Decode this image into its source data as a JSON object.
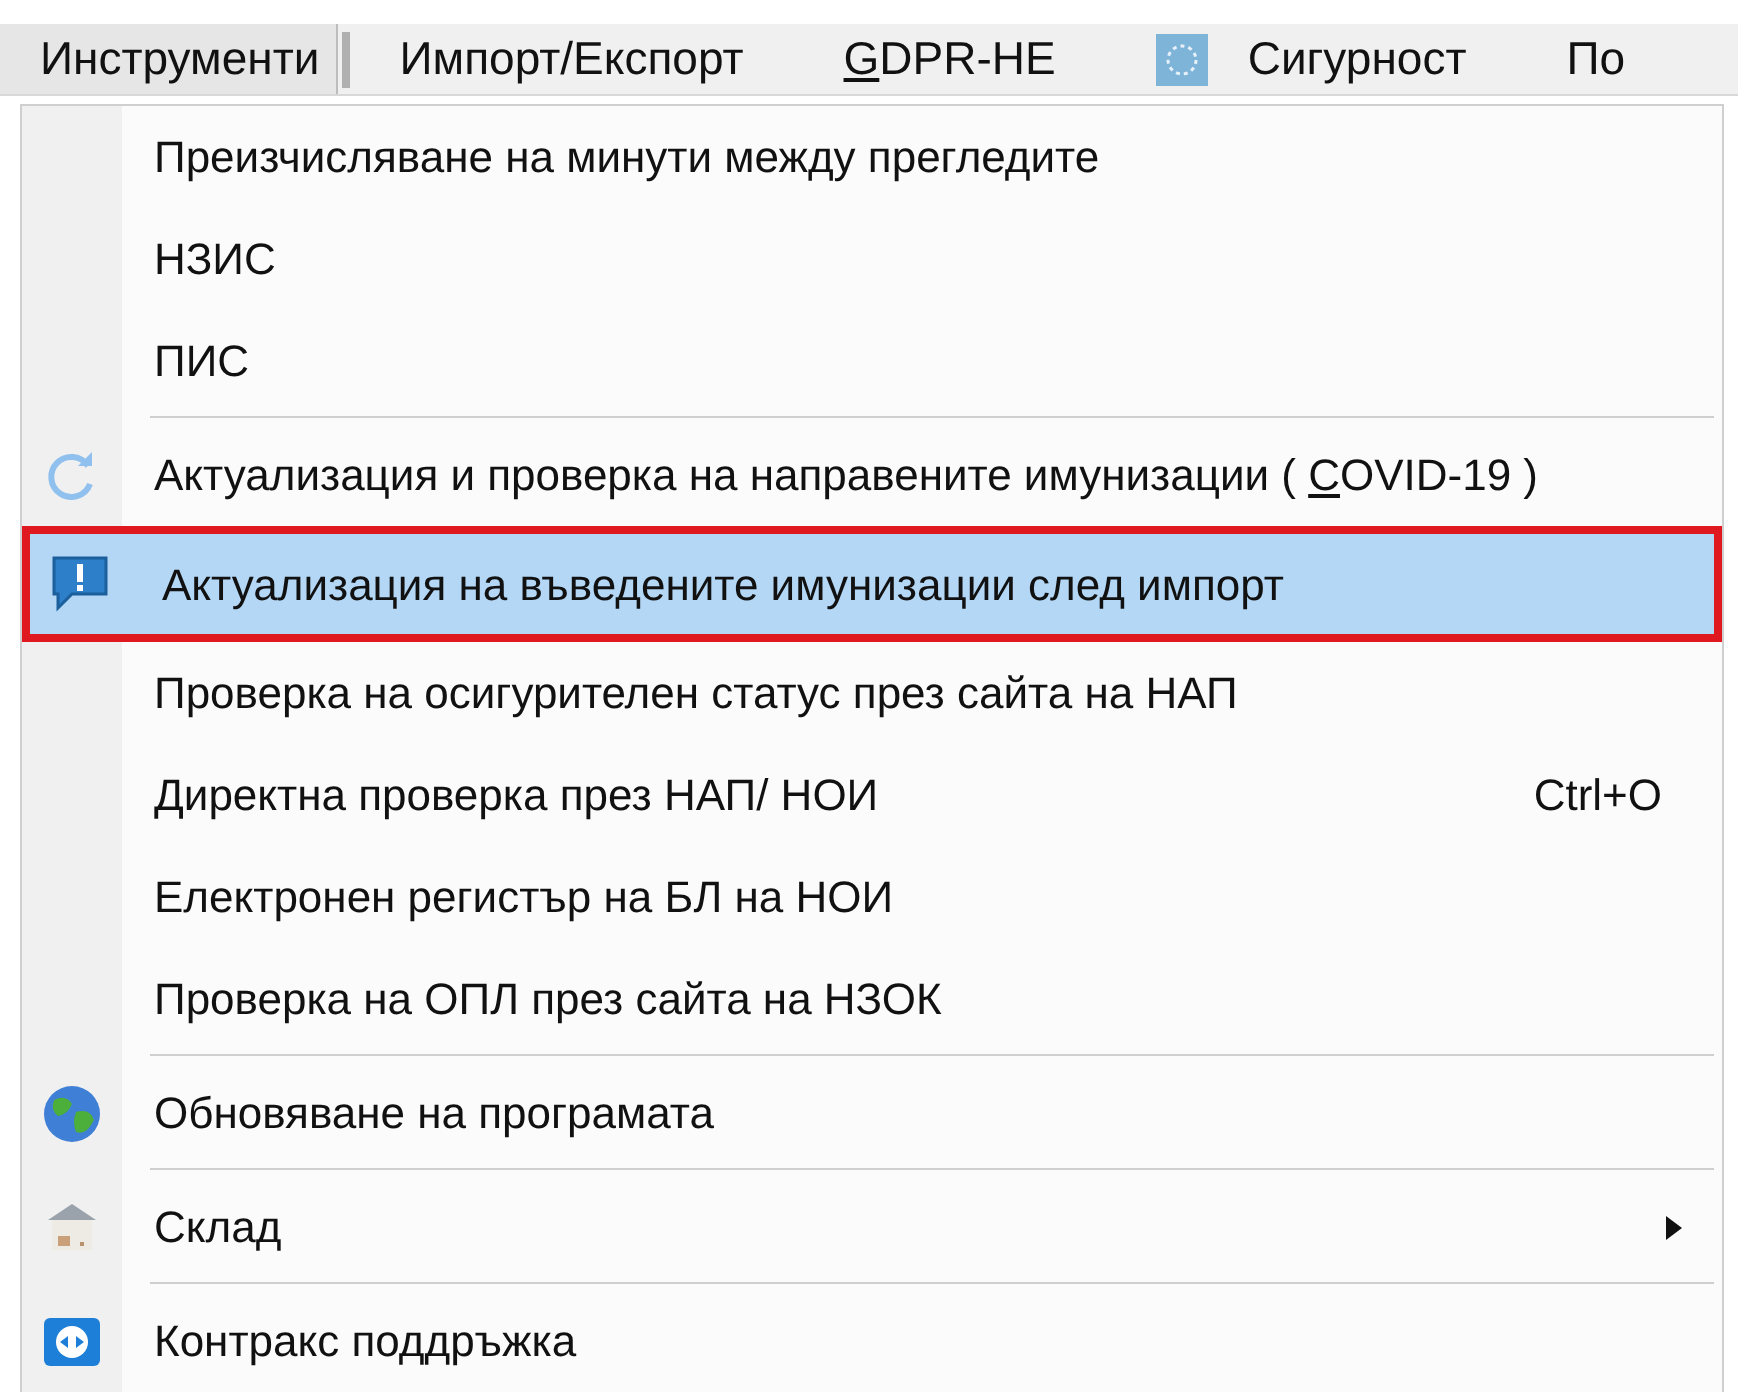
{
  "menubar": [
    {
      "label": "Инструменти",
      "selected": true
    },
    {
      "label": "Импорт/Експорт",
      "selected": false
    },
    {
      "label_parts": [
        {
          "text": "G",
          "underlined": true
        },
        {
          "text": "DPR-НЕ",
          "underlined": false
        }
      ],
      "selected": false
    },
    {
      "label": "Сигурност",
      "selected": false
    },
    {
      "label": "По",
      "selected": false
    }
  ],
  "menu": [
    {
      "kind": "item",
      "label": "Преизчисляване на минути между прегледите",
      "selected": false
    },
    {
      "kind": "item",
      "label": "НЗИС",
      "selected": false
    },
    {
      "kind": "item",
      "label": "ПИС",
      "selected": false
    },
    {
      "kind": "separator"
    },
    {
      "kind": "item",
      "label_parts": [
        {
          "text": "Актуализация и проверка на направените имунизации ( ",
          "underlined": false
        },
        {
          "text": "C",
          "underlined": true
        },
        {
          "text": "OVID-19 )",
          "underlined": false
        }
      ],
      "selected": false
    },
    {
      "kind": "item",
      "label": "Актуализация на въведените имунизации след импорт",
      "selected": true,
      "outlined": true
    },
    {
      "kind": "item",
      "label": "Проверка на осигурителен статус през сайта на  НАП",
      "selected": false
    },
    {
      "kind": "item",
      "label": "Директна проверка през НАП/ НОИ",
      "shortcut": "Ctrl+O",
      "selected": false
    },
    {
      "kind": "item",
      "label": "Електронен регистър на БЛ на НОИ",
      "selected": false
    },
    {
      "kind": "item",
      "label": "Проверка на ОПЛ през сайта на НЗОК",
      "selected": false
    },
    {
      "kind": "separator"
    },
    {
      "kind": "item",
      "label": "Обновяване на програмата",
      "selected": false
    },
    {
      "kind": "separator"
    },
    {
      "kind": "item",
      "label": "Склад",
      "selected": false,
      "submenu": true
    },
    {
      "kind": "separator"
    },
    {
      "kind": "item",
      "label": "Контракс поддръжка",
      "selected": false
    }
  ]
}
